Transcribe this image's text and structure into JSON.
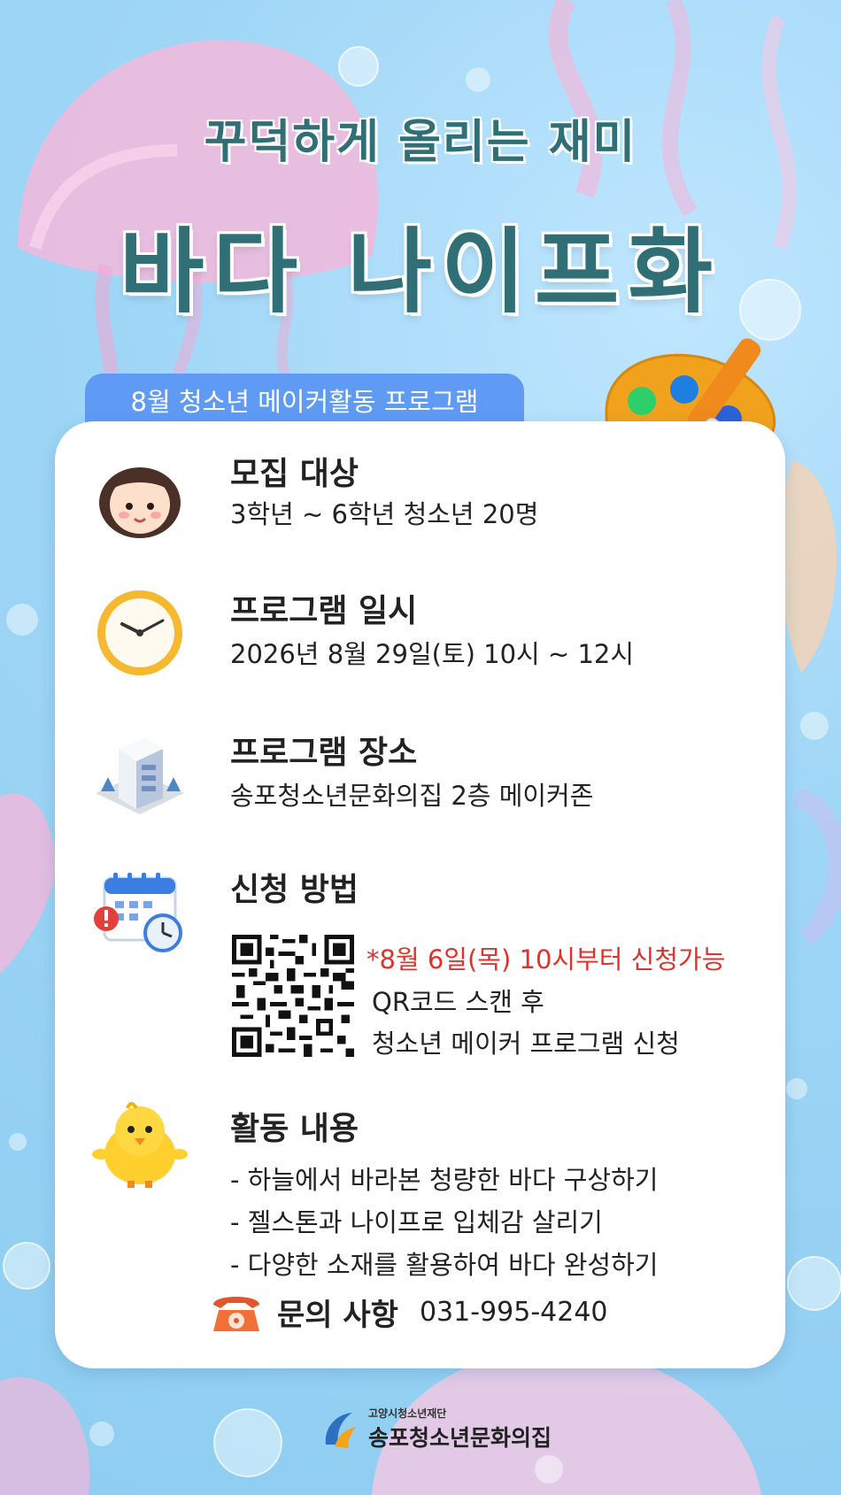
{
  "poster": {
    "subtitle": "꾸덕하게 올리는 재미",
    "title": "바다 나이프화",
    "tagline": "8월 청소년 메이커활동 프로그램"
  },
  "sections": [
    {
      "icon": "girl-face-icon",
      "heading": "모집 대상",
      "lines": [
        "3학년 ~ 6학년 청소년 20명"
      ]
    },
    {
      "icon": "clock-icon",
      "heading": "프로그램 일시",
      "lines": [
        "2026년 8월 29일(토) 10시 ~ 12시"
      ]
    },
    {
      "icon": "building-icon",
      "heading": "프로그램 장소",
      "lines": [
        "송포청소년문화의집 2층 메이커존"
      ]
    },
    {
      "icon": "calendar-icon",
      "heading": "신청 방법",
      "lines": [
        "*8월 6일(목) 10시부터 신청가능",
        "QR코드 스캔 후",
        "청소년 메이커 프로그램 신청"
      ]
    },
    {
      "icon": "chick-icon",
      "heading": "활동 내용",
      "lines": [
        "- 하늘에서 바라본 청량한 바다 구상하기",
        "- 젤스톤과 나이프로 입체감 살리기",
        "- 다양한 소재를 활용하여 바다 완성하기"
      ]
    }
  ],
  "contact": {
    "icon": "telephone-icon",
    "label": "문의 사항",
    "phone": "031-995-4240"
  },
  "footer": {
    "org_sub": "고양시청소년재단",
    "org_main": "송포청소년문화의집"
  },
  "colors": {
    "title": "#2f6f75",
    "tagline_bg": "#5f9af5",
    "highlight": "#e0312b",
    "background": "#8ecdf1"
  }
}
